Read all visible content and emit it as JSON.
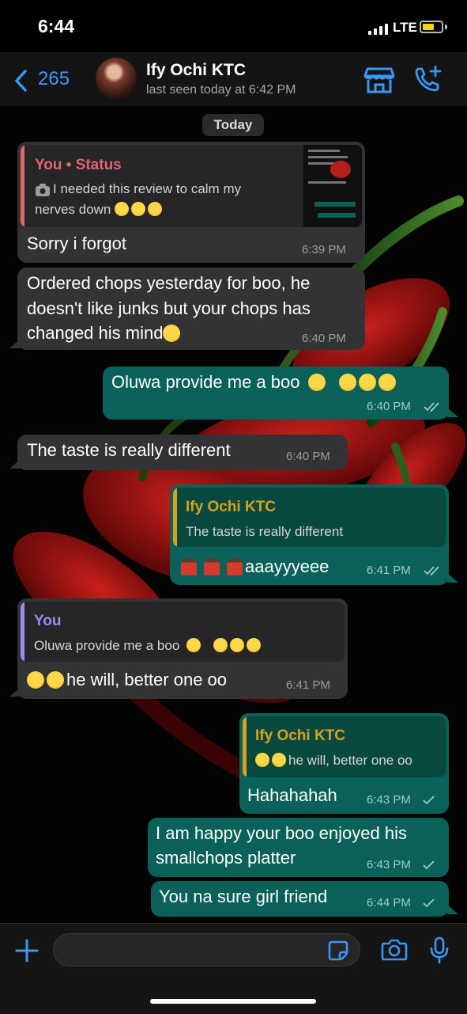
{
  "status_bar": {
    "time": "6:44",
    "network": "LTE",
    "battery_color": "#f2d20b"
  },
  "header": {
    "back_count": "265",
    "contact_name": "Ify Ochi KTC",
    "last_seen": "last seen today at 6:42 PM",
    "icons": [
      "chevron-left-icon",
      "store-icon",
      "phone-add-icon"
    ]
  },
  "chat": {
    "day_label": "Today",
    "messages": [
      {
        "dir": "in",
        "quote_title": "You • Status",
        "quote_body_1": "I needed this review to calm my",
        "quote_body_2": "nerves down",
        "text": "Sorry i forgot",
        "time": "6:39 PM"
      },
      {
        "dir": "in",
        "text_1": "Ordered chops yesterday for boo, he",
        "text_2": "doesn't like junks but your chops has",
        "text_3": "changed his mind",
        "time": "6:40 PM"
      },
      {
        "dir": "out",
        "text": "Oluwa provide me a boo",
        "time": "6:40 PM",
        "status": "read"
      },
      {
        "dir": "in",
        "text": "The taste is really different",
        "time": "6:40 PM"
      },
      {
        "dir": "out",
        "quote_title": "Ify Ochi KTC",
        "quote_body": "The taste is really different",
        "text": "aaayyyeee",
        "time": "6:41 PM",
        "status": "read"
      },
      {
        "dir": "in",
        "quote_title": "You",
        "quote_body": "Oluwa provide me a boo",
        "text": "he will, better one oo",
        "time": "6:41 PM"
      },
      {
        "dir": "out",
        "quote_title": "Ify Ochi KTC",
        "quote_body": "he will, better one oo",
        "text": "Hahahahah",
        "time": "6:43 PM",
        "status": "sent"
      },
      {
        "dir": "out",
        "text_1": "I am happy your boo enjoyed his",
        "text_2": "smallchops platter",
        "time": "6:43 PM",
        "status": "sent"
      },
      {
        "dir": "out",
        "text": "You na sure girl friend",
        "time": "6:44 PM",
        "status": "sent"
      }
    ]
  },
  "colors": {
    "accent": "#3b97f5",
    "incoming_bubble": "#333335",
    "outgoing_bubble": "#0a615a",
    "status_quote_title": "#e4646c",
    "contact_quote_title": "#d9a21b",
    "you_quote_title": "#9b8cf0"
  },
  "input_bar": {
    "icons": [
      "plus-icon",
      "sticker-icon",
      "camera-icon",
      "microphone-icon"
    ]
  }
}
